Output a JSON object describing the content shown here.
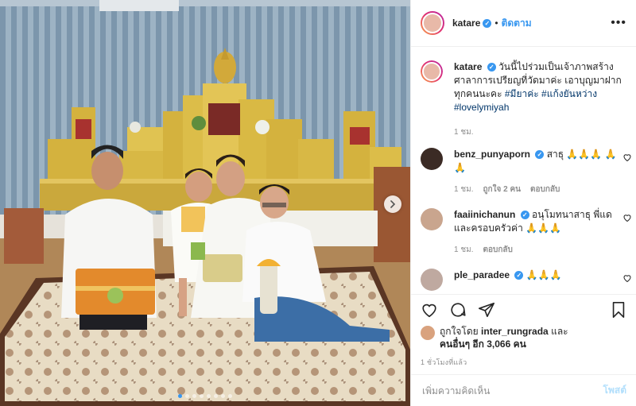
{
  "post": {
    "username": "katare",
    "follow_sep": "•",
    "follow_label": "ติดตาม",
    "more_icon": "more-icon"
  },
  "caption": {
    "username": "katare",
    "text": "วันนี้ไปร่วมเป็นเจ้าภาพสร้างศาลาการเปรียญที่วัดมาค่ะ เอาบุญมาฝากทุกคนนะคะ",
    "hashtags": [
      "#มียาค่ะ",
      "#แก้งยันหว่าง",
      "#lovelymiyah"
    ],
    "time": "1 ชม."
  },
  "comments": [
    {
      "username": "benz_punyaporn",
      "text": "สาธุ 🙏🙏🙏 🙏🙏",
      "time": "1 ชม.",
      "likes": "ถูกใจ 2 คน",
      "reply": "ตอบกลับ"
    },
    {
      "username": "faaiinichanun",
      "text": "อนุโมทนาสาธุ พี่แดและครอบครัวค่า 🙏🙏🙏",
      "time": "1 ชม.",
      "reply": "ตอบกลับ"
    },
    {
      "username": "ple_paradee",
      "text": "🙏🙏🙏"
    }
  ],
  "likes": {
    "prefix": "ถูกใจโดย",
    "user": "inter_rungrada",
    "and": "และ",
    "others": "คนอื่นๆ อีก 3,066 คน"
  },
  "time_ago": "1 ชั่วโมงที่แล้ว",
  "add_comment": {
    "placeholder": "เพิ่มความคิดเห็น",
    "post_label": "โพสต์"
  },
  "carousel": {
    "count": 8,
    "active_index": 0
  },
  "colors": {
    "accent": "#3897f0",
    "hashtag": "#003569",
    "muted": "#8e8e8e",
    "post_disabled": "#b2dffc"
  }
}
